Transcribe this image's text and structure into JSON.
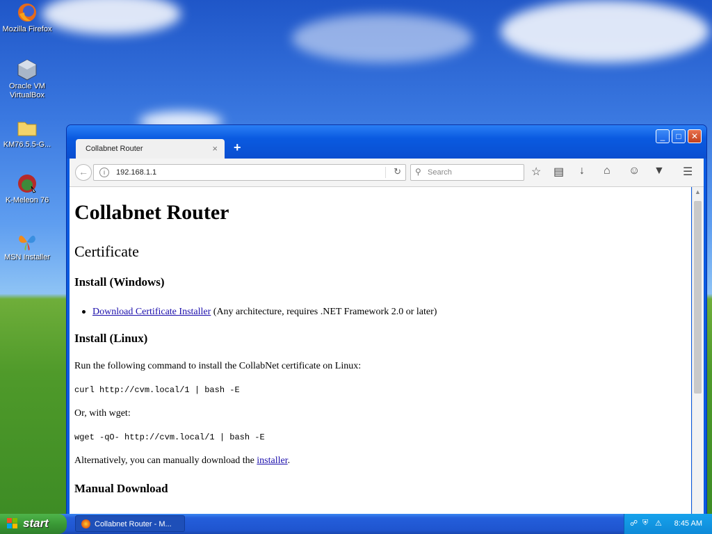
{
  "desktop": {
    "icons": [
      {
        "label": "Mozilla Firefox"
      },
      {
        "label": "Oracle VM VirtualBox"
      },
      {
        "label": "KM76.5.5-G..."
      },
      {
        "label": "K-Meleon 76"
      },
      {
        "label": "MSN Installer"
      }
    ]
  },
  "browser": {
    "tab_title": "Collabnet Router",
    "tab_close": "×",
    "new_tab": "+",
    "url": "192.168.1.1",
    "search_placeholder": "Search",
    "window_buttons": {
      "minimize": "_",
      "maximize": "□",
      "close": "✕"
    }
  },
  "page": {
    "h1": "Collabnet Router",
    "h2": "Certificate",
    "install_windows": "Install (Windows)",
    "download_link": "Download Certificate Installer",
    "download_note": " (Any architecture, requires .NET Framework 2.0 or later)",
    "install_linux": "Install (Linux)",
    "linux_intro": "Run the following command to install the CollabNet certificate on Linux:",
    "curl_cmd": "curl http://cvm.local/1 | bash -E",
    "or_wget": "Or, with wget:",
    "wget_cmd": "wget -qO- http://cvm.local/1 | bash -E",
    "alt_text": "Alternatively, you can manually download the ",
    "installer_link": "installer",
    "alt_end": ".",
    "manual_download": "Manual Download"
  },
  "taskbar": {
    "start_label": "start",
    "task_label": "Collabnet Router - M...",
    "clock": "8:45 AM"
  }
}
